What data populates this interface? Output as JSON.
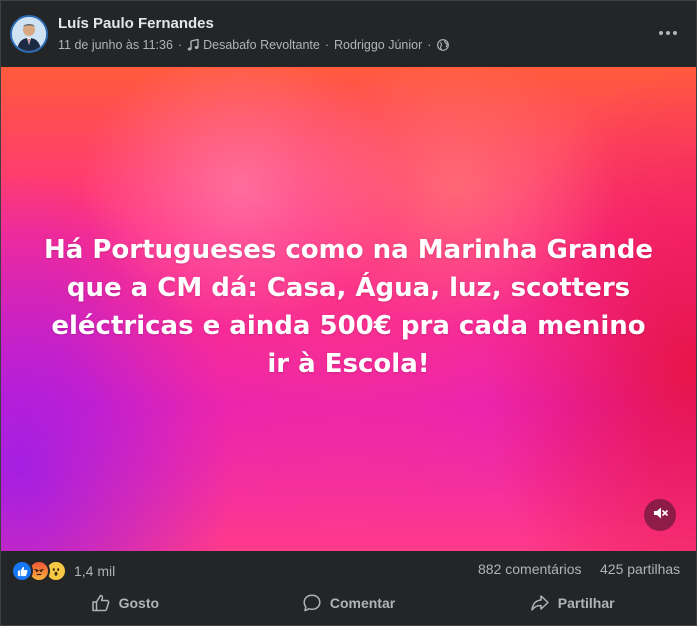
{
  "post": {
    "author": "Luís Paulo Fernandes",
    "date": "11 de junho às 11:36",
    "audio_title": "Desabafo Revoltante",
    "audio_artist": "Rodriggo Júnior",
    "privacy_icon": "globe-icon"
  },
  "media": {
    "text": "Há Portugueses como na Marinha Grande que a CM dá: Casa, Água, luz, scotters eléctricas e ainda 500€ pra cada menino ir à Escola!",
    "mute_icon": "speaker-muted-icon"
  },
  "stats": {
    "reactions": [
      "like",
      "angry",
      "wow"
    ],
    "reaction_count": "1,4 mil",
    "comments": "882 comentários",
    "shares": "425 partilhas"
  },
  "actions": {
    "like_label": "Gosto",
    "comment_label": "Comentar",
    "share_label": "Partilhar"
  },
  "colors": {
    "background": "#242526",
    "text_primary": "#e4e6eb",
    "text_secondary": "#b0b3b8",
    "like_blue": "#1877f2"
  }
}
